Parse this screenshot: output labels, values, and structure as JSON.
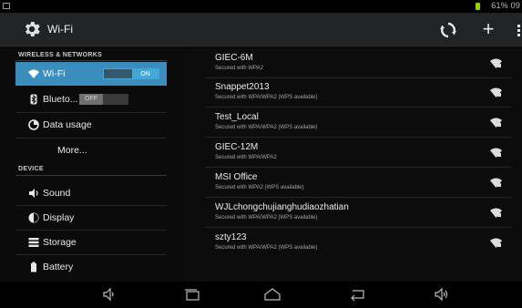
{
  "status_bar": {
    "right_text": "61% 09"
  },
  "action_bar": {
    "title": "Wi-Fi"
  },
  "sidebar": {
    "sections": [
      {
        "header": "WIRELESS & NETWORKS"
      },
      {
        "header": "DEVICE"
      }
    ],
    "items": [
      {
        "label": "Wi-Fi",
        "icon": "wifi-icon",
        "toggle": "ON"
      },
      {
        "label": "Blueto...",
        "icon": "bluetooth-icon",
        "toggle": "OFF"
      },
      {
        "label": "Data usage",
        "icon": "data-usage-icon"
      },
      {
        "label": "More..."
      },
      {
        "label": "Sound",
        "icon": "volume-icon"
      },
      {
        "label": "Display",
        "icon": "display-icon"
      },
      {
        "label": "Storage",
        "icon": "storage-icon"
      },
      {
        "label": "Battery",
        "icon": "battery-icon"
      }
    ]
  },
  "networks": [
    {
      "ssid": "GIEC-6M",
      "security": "Secured with WPA2"
    },
    {
      "ssid": "Snappet2013",
      "security": "Secured with WPA/WPA2 (WPS available)"
    },
    {
      "ssid": "Test_Local",
      "security": "Secured with WPA/WPA2 (WPS available)"
    },
    {
      "ssid": "GIEC-12M",
      "security": "Secured with WPA/WPA2"
    },
    {
      "ssid": "MSI Office",
      "security": "Secured with WPA2 (WPS available)"
    },
    {
      "ssid": "WJLchongchujianghudiaozhatian",
      "security": "Secured with WPA/WPA2 (WPS available)"
    },
    {
      "ssid": "szty123",
      "security": "Secured with WPA/WPA2 (WPS available)"
    }
  ],
  "colors": {
    "accent": "#3a8dbd",
    "battery": "#8fd400"
  }
}
